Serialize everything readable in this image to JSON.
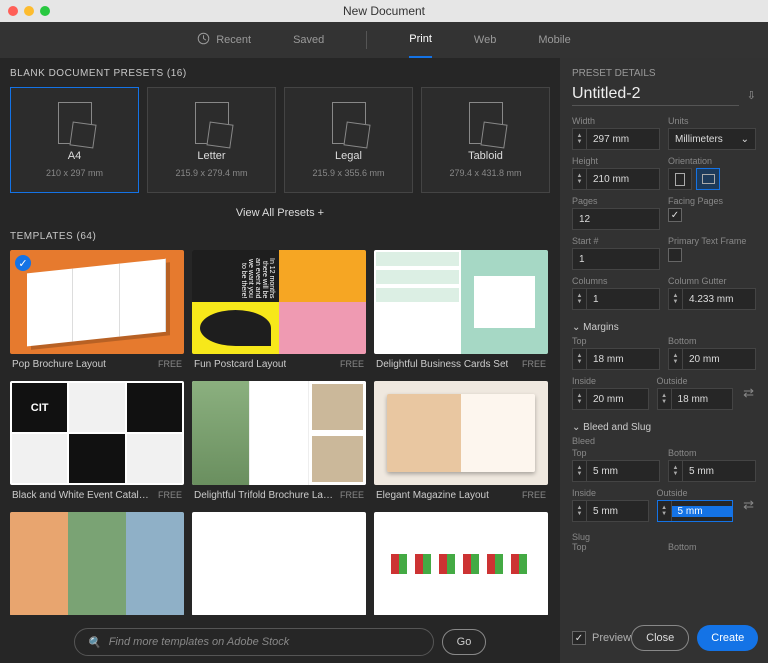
{
  "window": {
    "title": "New Document"
  },
  "tabs": {
    "recent": "Recent",
    "saved": "Saved",
    "print": "Print",
    "web": "Web",
    "mobile": "Mobile"
  },
  "presets": {
    "section": "BLANK DOCUMENT PRESETS  (16)",
    "items": [
      {
        "name": "A4",
        "dims": "210 x 297 mm"
      },
      {
        "name": "Letter",
        "dims": "215.9 x 279.4 mm"
      },
      {
        "name": "Legal",
        "dims": "215.9 x 355.6 mm"
      },
      {
        "name": "Tabloid",
        "dims": "279.4 x 431.8 mm"
      }
    ],
    "viewAll": "View All Presets  +"
  },
  "templates": {
    "section": "TEMPLATES  (64)",
    "items": [
      {
        "name": "Pop Brochure Layout",
        "price": "FREE",
        "selected": true
      },
      {
        "name": "Fun Postcard Layout",
        "price": "FREE"
      },
      {
        "name": "Delightful Business Cards Set",
        "price": "FREE"
      },
      {
        "name": "Black and White Event Catalog L…",
        "price": "FREE"
      },
      {
        "name": "Delightful Trifold Brochure Layout",
        "price": "FREE"
      },
      {
        "name": "Elegant Magazine Layout",
        "price": "FREE"
      }
    ]
  },
  "search": {
    "placeholder": "Find more templates on Adobe Stock",
    "go": "Go"
  },
  "details": {
    "header": "PRESET DETAILS",
    "docname": "Untitled-2",
    "width": {
      "label": "Width",
      "value": "297 mm"
    },
    "units": {
      "label": "Units",
      "value": "Millimeters"
    },
    "height": {
      "label": "Height",
      "value": "210 mm"
    },
    "orientation": {
      "label": "Orientation"
    },
    "pages": {
      "label": "Pages",
      "value": "12"
    },
    "facingPages": {
      "label": "Facing Pages",
      "checked": true
    },
    "start": {
      "label": "Start #",
      "value": "1"
    },
    "primaryTextFrame": {
      "label": "Primary Text Frame",
      "checked": false
    },
    "columns": {
      "label": "Columns",
      "value": "1"
    },
    "gutter": {
      "label": "Column Gutter",
      "value": "4.233 mm"
    },
    "marginsTitle": "Margins",
    "margins": {
      "top": {
        "label": "Top",
        "value": "18 mm"
      },
      "bottom": {
        "label": "Bottom",
        "value": "20 mm"
      },
      "inside": {
        "label": "Inside",
        "value": "20 mm"
      },
      "outside": {
        "label": "Outside",
        "value": "18 mm"
      }
    },
    "bleedTitle": "Bleed and Slug",
    "bleedLabel": "Bleed",
    "bleed": {
      "top": {
        "label": "Top",
        "value": "5 mm"
      },
      "bottom": {
        "label": "Bottom",
        "value": "5 mm"
      },
      "inside": {
        "label": "Inside",
        "value": "5 mm"
      },
      "outside": {
        "label": "Outside",
        "value": "5 mm"
      }
    },
    "slugLabel": "Slug",
    "slug": {
      "top": "Top",
      "bottom": "Bottom"
    },
    "preview": {
      "label": "Preview",
      "checked": true
    },
    "close": "Close",
    "create": "Create"
  }
}
